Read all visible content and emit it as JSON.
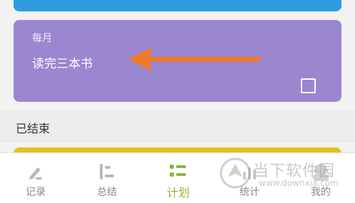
{
  "plan_card": {
    "frequency": "每月",
    "title": "读完三本书",
    "completed": false
  },
  "section": {
    "label": "已结束"
  },
  "nav": {
    "items": [
      {
        "label": "记录",
        "icon": "pencil-icon",
        "active": false
      },
      {
        "label": "总结",
        "icon": "summary-icon",
        "active": false
      },
      {
        "label": "计划",
        "icon": "plan-list-icon",
        "active": true
      },
      {
        "label": "统计",
        "icon": "stats-icon",
        "active": false
      },
      {
        "label": "我的",
        "icon": "profile-icon",
        "active": false
      }
    ]
  },
  "watermark": {
    "text": "当下软件园",
    "url": "www.downxia.com"
  },
  "colors": {
    "blue_card": "#2e9be3",
    "purple_card": "#9b86d0",
    "yellow_card": "#e3c21f",
    "nav_active": "#8cb743",
    "arrow": "#f07a28"
  }
}
